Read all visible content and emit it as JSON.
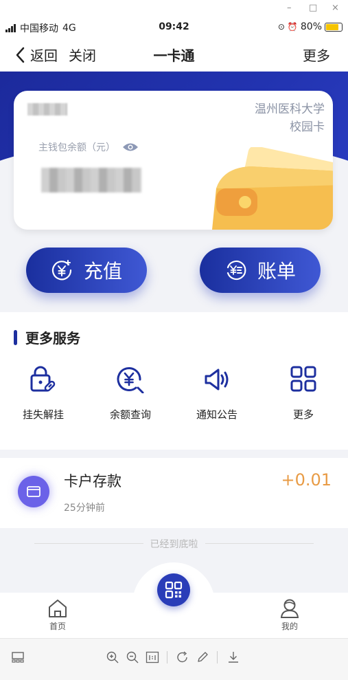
{
  "window_controls": {
    "minimize": "–",
    "maximize": "□",
    "close": "×"
  },
  "status_bar": {
    "carrier": "中国移动",
    "network": "4G",
    "time": "09:42",
    "battery": "80%",
    "battery_level": 0.8
  },
  "nav": {
    "back_label": "返回",
    "close_label": "关闭",
    "title": "一卡通",
    "more_label": "更多"
  },
  "card": {
    "school_line1": "温州医科大学",
    "school_line2": "校园卡",
    "balance_label": "主钱包余额（元）"
  },
  "actions": {
    "recharge_label": "充值",
    "bill_label": "账单"
  },
  "services": {
    "title": "更多服务",
    "items": [
      {
        "label": "挂失解挂",
        "icon": "lock-link-icon"
      },
      {
        "label": "余额查询",
        "icon": "yuan-search-icon"
      },
      {
        "label": "通知公告",
        "icon": "speaker-icon"
      },
      {
        "label": "更多",
        "icon": "grid-icon"
      }
    ]
  },
  "record": {
    "title": "卡户存款",
    "time": "25分钟前",
    "amount": "+0.01"
  },
  "end_text": "已经到底啦",
  "tabs": {
    "home_label": "首页",
    "mine_label": "我的"
  },
  "colors": {
    "primary": "#1d2f9f",
    "accent": "#e89b45",
    "record_icon": "#6b62e8"
  }
}
